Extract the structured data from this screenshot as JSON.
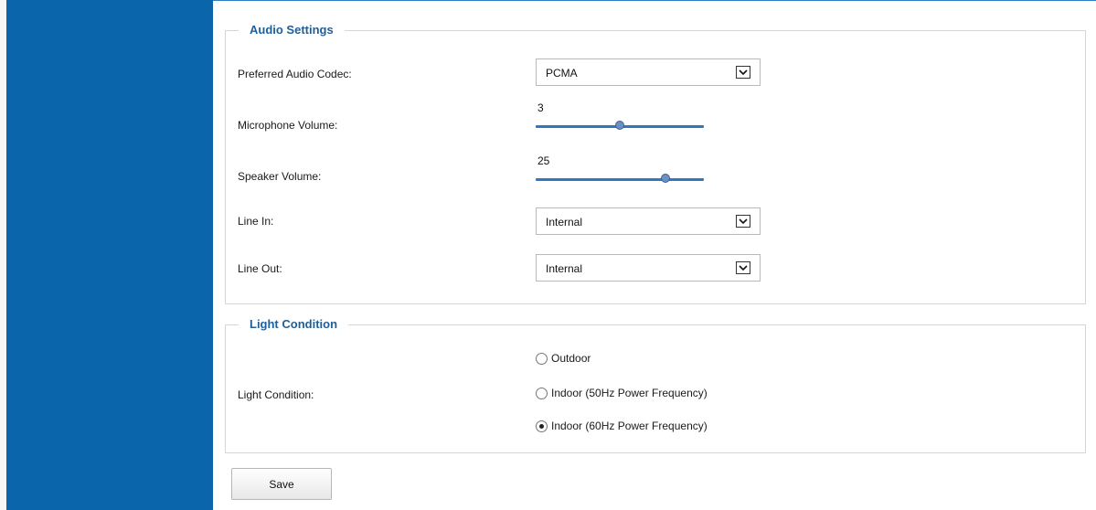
{
  "audio": {
    "section_title": "Audio Settings",
    "codec": {
      "label": "Preferred Audio Codec:",
      "value": "PCMA"
    },
    "mic": {
      "label": "Microphone Volume:",
      "value": "3",
      "fraction": 0.5
    },
    "speaker": {
      "label": "Speaker Volume:",
      "value": "25",
      "fraction": 0.77
    },
    "line_in": {
      "label": "Line In:",
      "value": "Internal"
    },
    "line_out": {
      "label": "Line Out:",
      "value": "Internal"
    }
  },
  "light": {
    "section_title": "Light Condition",
    "label": "Light Condition:",
    "options": [
      {
        "label": "Outdoor",
        "checked": false
      },
      {
        "label": "Indoor (50Hz Power Frequency)",
        "checked": false
      },
      {
        "label": "Indoor (60Hz Power Frequency)",
        "checked": true
      }
    ]
  },
  "actions": {
    "save_label": "Save"
  },
  "colors": {
    "sidebar": "#0a65ab",
    "legend": "#1f5f99",
    "slider_track": "#2f77bf"
  }
}
